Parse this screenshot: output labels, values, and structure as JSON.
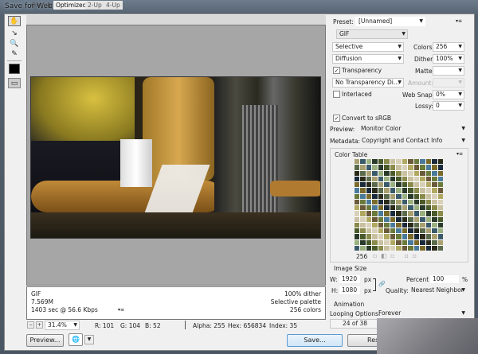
{
  "window": {
    "title": "Save for Web (31.4%)"
  },
  "tabs": [
    "Original",
    "Optimized",
    "2-Up",
    "4-Up"
  ],
  "active_tab": "Optimized",
  "tools": [
    "hand-icon",
    "slice-select-icon",
    "zoom-icon",
    "eyedropper-icon"
  ],
  "info_left": [
    "GIF",
    "7.569M",
    "1403 sec @ 56.6 Kbps"
  ],
  "info_right": [
    "100% dither",
    "Selective palette",
    "256 colors"
  ],
  "status": {
    "zoom": "31.4%",
    "r": "R: 101",
    "g": "G: 104",
    "b": "B: 52",
    "alpha": "Alpha: 255",
    "hex": "Hex: 656834",
    "index": "Index: 35"
  },
  "buttons": {
    "preview": "Preview...",
    "save": "Save...",
    "reset": "Res"
  },
  "settings": {
    "preset_label": "Preset:",
    "preset": "[Unnamed]",
    "format": "GIF",
    "reduction": "Selective",
    "colors_label": "Colors:",
    "colors": "256",
    "dither_algo": "Diffusion",
    "dither_label": "Dither:",
    "dither": "100%",
    "transparency": "Transparency",
    "transparency_checked": true,
    "matte_label": "Matte:",
    "matte": "",
    "transparency_dither": "No Transparency Di...",
    "amount_label": "Amount:",
    "interlaced": "Interlaced",
    "interlaced_checked": false,
    "websnap_label": "Web Snap:",
    "websnap": "0%",
    "lossy_label": "Lossy:",
    "lossy": "0",
    "convert_srgb": "Convert to sRGB",
    "convert_checked": true,
    "preview_label": "Preview:",
    "preview": "Monitor Color",
    "metadata_label": "Metadata:",
    "metadata": "Copyright and Contact Info"
  },
  "color_table": {
    "label": "Color Table",
    "count": "256",
    "palette": [
      "#4a5a2a",
      "#8a8a4a",
      "#6a7a3a",
      "#2a3a2a",
      "#a8a070",
      "#3a5a6a",
      "#c8c0a0",
      "#5a6a4a",
      "#7a6a2a",
      "#1a2a3a",
      "#9ab080",
      "#4a7a9a",
      "#b0a860",
      "#6a5a3a",
      "#2a2a1a",
      "#d8d0b8"
    ]
  },
  "image_size": {
    "label": "Image Size",
    "w_label": "W:",
    "w": "1920",
    "h_label": "H:",
    "h": "1080",
    "unit": "px",
    "percent_label": "Percent:",
    "percent": "100",
    "percent_unit": "%",
    "quality_label": "Quality:",
    "quality": "Nearest Neighbor"
  },
  "animation": {
    "label": "Animation",
    "looping_label": "Looping Options:",
    "looping": "Forever",
    "frame": "24 of 38"
  }
}
